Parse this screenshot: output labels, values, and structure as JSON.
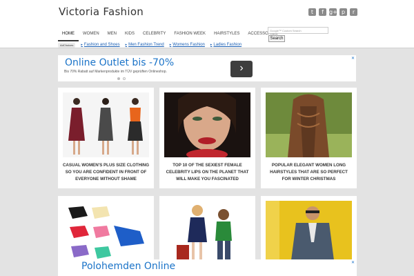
{
  "site": {
    "title": "Victoria Fashion"
  },
  "social": {
    "icons": [
      "twitter-icon",
      "facebook-icon",
      "google-plus-icon",
      "pinterest-icon",
      "rss-icon"
    ],
    "glyphs": [
      "t",
      "f",
      "g+",
      "p",
      "r"
    ]
  },
  "nav": {
    "items": [
      "HOME",
      "WOMEN",
      "MEN",
      "KIDS",
      "CELEBRITY",
      "FASHION WEEK",
      "HAIRSTYLES",
      "ACCESSORIES"
    ],
    "active": "HOME"
  },
  "search": {
    "placeholder": "Google™ Custom Search",
    "button": "Search"
  },
  "adchoices": {
    "badge": "AdChoices",
    "links": [
      "Fashion and Shoes",
      "Men Fashion Trend",
      "Womens Fashion",
      "Ladies Fashion"
    ]
  },
  "ads": {
    "top": {
      "title": "Online Outlet bis -70%",
      "subtitle": "Bis 70% Rabatt auf Markenprodukte im TÜV geprüften Onlineshop.",
      "arrow": "›"
    },
    "bottom": {
      "title": "Polohemden Online",
      "subtitle": "",
      "arrow": "›"
    }
  },
  "posts": [
    {
      "caption": "CASUAL WOMEN'S PLUS SIZE CLOTHING SO YOU ARE CONFIDENT IN FRONT OF EVERYONE WITHOUT SHAME"
    },
    {
      "caption": "TOP 10 OF THE SEXIEST FEMALE CELEBRITY LIPS ON THE PLANET THAT WILL MAKE YOU FASCINATED"
    },
    {
      "caption": "POPULAR ELEGANT WOMEN LONG HAIRSTYLES THAT ARE SO PERFECT FOR WINTER CHRISTMAS"
    },
    {
      "caption": ""
    },
    {
      "caption": ""
    },
    {
      "caption": ""
    }
  ],
  "colors": {
    "accent": "#1a73c8",
    "link": "#1a5fb4",
    "background": "#e3e3e3"
  }
}
